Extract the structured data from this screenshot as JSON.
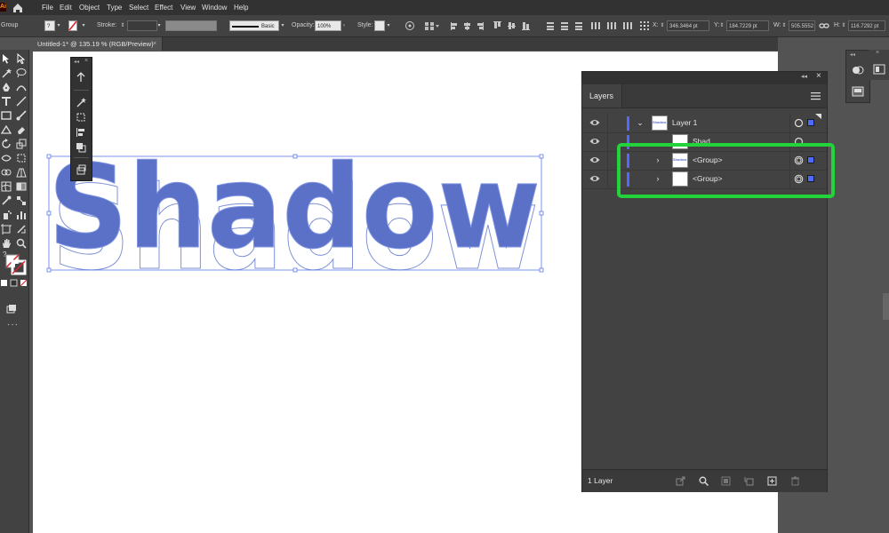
{
  "app": {
    "logo_text": "Ai",
    "menu": [
      "File",
      "Edit",
      "Object",
      "Type",
      "Select",
      "Effect",
      "View",
      "Window",
      "Help"
    ]
  },
  "control_bar": {
    "selection_label": "Group",
    "stroke_label": "Stroke:",
    "brush_label": "Basic",
    "opacity_label": "Opacity:",
    "opacity_value": "100%",
    "style_label": "Style:",
    "x_label": "X:",
    "x_value": "346.3464 pt",
    "y_label": "Y:",
    "y_value": "184.7229 pt",
    "w_label": "W:",
    "w_value": "505.5552 pt",
    "h_label": "H:",
    "h_value": "116.7292 pt"
  },
  "document": {
    "tab_title": "Untitled-1* @ 135.19 % (RGB/Preview)",
    "close_glyph": "×",
    "artwork_text": "Shadow",
    "artwork_color": "#5b70c7"
  },
  "layers_panel": {
    "title": "Layers",
    "collapse_glyph": "◂◂",
    "close_glyph": "×",
    "rows": [
      {
        "name": "Layer 1",
        "thumb_text": "Shadow",
        "expanded": true
      },
      {
        "name": "Shad..."
      },
      {
        "name": "<Group>",
        "thumb_text": "Shadow"
      },
      {
        "name": "<Group>"
      }
    ],
    "footer_count": "1 Layer"
  },
  "colors": {
    "accent_blue": "#4f6bff",
    "highlight_green": "#22d33a"
  }
}
